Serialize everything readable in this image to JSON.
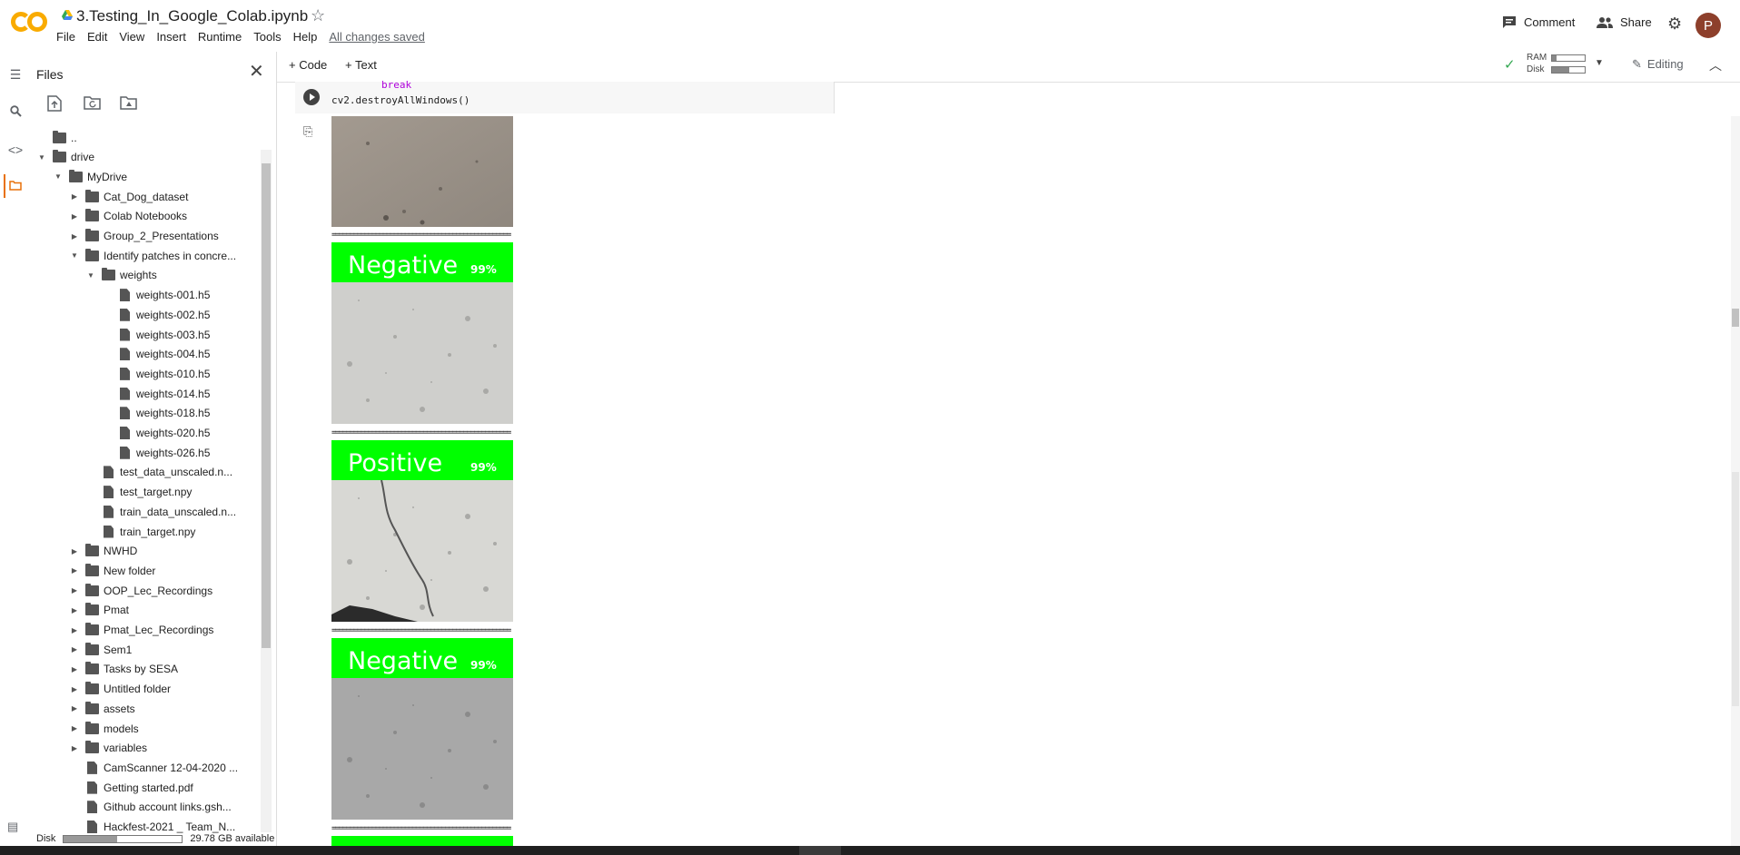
{
  "header": {
    "notebook_title": "3.Testing_In_Google_Colab.ipynb",
    "menu": [
      "File",
      "Edit",
      "View",
      "Insert",
      "Runtime",
      "Tools",
      "Help"
    ],
    "save_status": "All changes saved",
    "comment_label": "Comment",
    "share_label": "Share",
    "avatar_letter": "P",
    "logo_text": "CO"
  },
  "toolbar": {
    "add_code": "+ Code",
    "add_text": "+ Text",
    "ram_label": "RAM",
    "disk_label": "Disk",
    "ram_usage": 0.15,
    "disk_usage": 0.55,
    "editing_label": "Editing"
  },
  "files_panel": {
    "title": "Files",
    "disk_label": "Disk",
    "disk_available": "29.78 GB available",
    "disk_used_fraction": 0.45,
    "tree": [
      {
        "label": "..",
        "type": "up",
        "depth": 0
      },
      {
        "label": "drive",
        "type": "folder",
        "depth": 0,
        "expanded": true
      },
      {
        "label": "MyDrive",
        "type": "folder",
        "depth": 1,
        "expanded": true
      },
      {
        "label": "Cat_Dog_dataset",
        "type": "folder",
        "depth": 2,
        "expanded": false
      },
      {
        "label": "Colab Notebooks",
        "type": "folder",
        "depth": 2,
        "expanded": false
      },
      {
        "label": "Group_2_Presentations",
        "type": "folder",
        "depth": 2,
        "expanded": false
      },
      {
        "label": "Identify patches in concre...",
        "type": "folder",
        "depth": 2,
        "expanded": true
      },
      {
        "label": "weights",
        "type": "folder",
        "depth": 3,
        "expanded": true
      },
      {
        "label": "weights-001.h5",
        "type": "file",
        "depth": 4
      },
      {
        "label": "weights-002.h5",
        "type": "file",
        "depth": 4
      },
      {
        "label": "weights-003.h5",
        "type": "file",
        "depth": 4
      },
      {
        "label": "weights-004.h5",
        "type": "file",
        "depth": 4
      },
      {
        "label": "weights-010.h5",
        "type": "file",
        "depth": 4
      },
      {
        "label": "weights-014.h5",
        "type": "file",
        "depth": 4
      },
      {
        "label": "weights-018.h5",
        "type": "file",
        "depth": 4
      },
      {
        "label": "weights-020.h5",
        "type": "file",
        "depth": 4
      },
      {
        "label": "weights-026.h5",
        "type": "file",
        "depth": 4
      },
      {
        "label": "test_data_unscaled.n...",
        "type": "file",
        "depth": 3
      },
      {
        "label": "test_target.npy",
        "type": "file",
        "depth": 3
      },
      {
        "label": "train_data_unscaled.n...",
        "type": "file",
        "depth": 3
      },
      {
        "label": "train_target.npy",
        "type": "file",
        "depth": 3
      },
      {
        "label": "NWHD",
        "type": "folder",
        "depth": 2,
        "expanded": false
      },
      {
        "label": "New folder",
        "type": "folder",
        "depth": 2,
        "expanded": false
      },
      {
        "label": "OOP_Lec_Recordings",
        "type": "folder",
        "depth": 2,
        "expanded": false
      },
      {
        "label": "Pmat",
        "type": "folder",
        "depth": 2,
        "expanded": false
      },
      {
        "label": "Pmat_Lec_Recordings",
        "type": "folder",
        "depth": 2,
        "expanded": false
      },
      {
        "label": "Sem1",
        "type": "folder",
        "depth": 2,
        "expanded": false
      },
      {
        "label": "Tasks by SESA",
        "type": "folder",
        "depth": 2,
        "expanded": false
      },
      {
        "label": "Untitled folder",
        "type": "folder",
        "depth": 2,
        "expanded": false
      },
      {
        "label": "assets",
        "type": "folder",
        "depth": 2,
        "expanded": false
      },
      {
        "label": "models",
        "type": "folder",
        "depth": 2,
        "expanded": false
      },
      {
        "label": "variables",
        "type": "folder",
        "depth": 2,
        "expanded": false
      },
      {
        "label": "CamScanner 12-04-2020 ...",
        "type": "file",
        "depth": 2
      },
      {
        "label": "Getting started.pdf",
        "type": "file",
        "depth": 2
      },
      {
        "label": "Github account links.gsh...",
        "type": "file",
        "depth": 2
      },
      {
        "label": "Hackfest-2021 _ Team_N...",
        "type": "file",
        "depth": 2
      }
    ]
  },
  "cell": {
    "code_line_1": "break",
    "code_line_2": "cv2.destroyAllWindows()"
  },
  "output": {
    "separator": "=================================================",
    "predictions": [
      {
        "label": "Negative",
        "confidence": "99%",
        "cracked": false
      },
      {
        "label": "Positive",
        "confidence": "99%",
        "cracked": true
      },
      {
        "label": "Negative",
        "confidence": "99%",
        "cracked": false
      }
    ],
    "label_color": "#00ff00"
  },
  "colors": {
    "accent_orange": "#e8710a",
    "check_green": "#34a853"
  },
  "icons": {
    "rail": [
      "toc-icon",
      "search-icon",
      "code-snippets-icon",
      "folder-icon"
    ],
    "file_tools": [
      "upload-icon",
      "refresh-folder-icon",
      "mount-drive-icon"
    ]
  }
}
